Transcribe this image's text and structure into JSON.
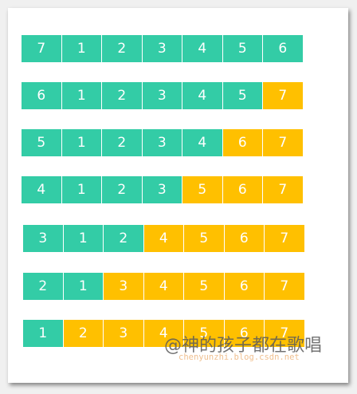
{
  "colors": {
    "unsorted": "#33CCA6",
    "sorted": "#FFC000"
  },
  "rows": [
    {
      "values": [
        "7",
        "1",
        "2",
        "3",
        "4",
        "5",
        "6"
      ],
      "sorted_count": 0
    },
    {
      "values": [
        "6",
        "1",
        "2",
        "3",
        "4",
        "5",
        "7"
      ],
      "sorted_count": 1
    },
    {
      "values": [
        "5",
        "1",
        "2",
        "3",
        "4",
        "6",
        "7"
      ],
      "sorted_count": 2
    },
    {
      "values": [
        "4",
        "1",
        "2",
        "3",
        "5",
        "6",
        "7"
      ],
      "sorted_count": 3
    },
    {
      "values": [
        "3",
        "1",
        "2",
        "4",
        "5",
        "6",
        "7"
      ],
      "sorted_count": 4
    },
    {
      "values": [
        "2",
        "1",
        "3",
        "4",
        "5",
        "6",
        "7"
      ],
      "sorted_count": 5
    },
    {
      "values": [
        "1",
        "2",
        "3",
        "4",
        "5",
        "6",
        "7"
      ],
      "sorted_count": 6
    }
  ],
  "watermark": {
    "author": "@神的孩子都在歌唱",
    "site": "chenyunzhi.blog.csdn.net"
  }
}
